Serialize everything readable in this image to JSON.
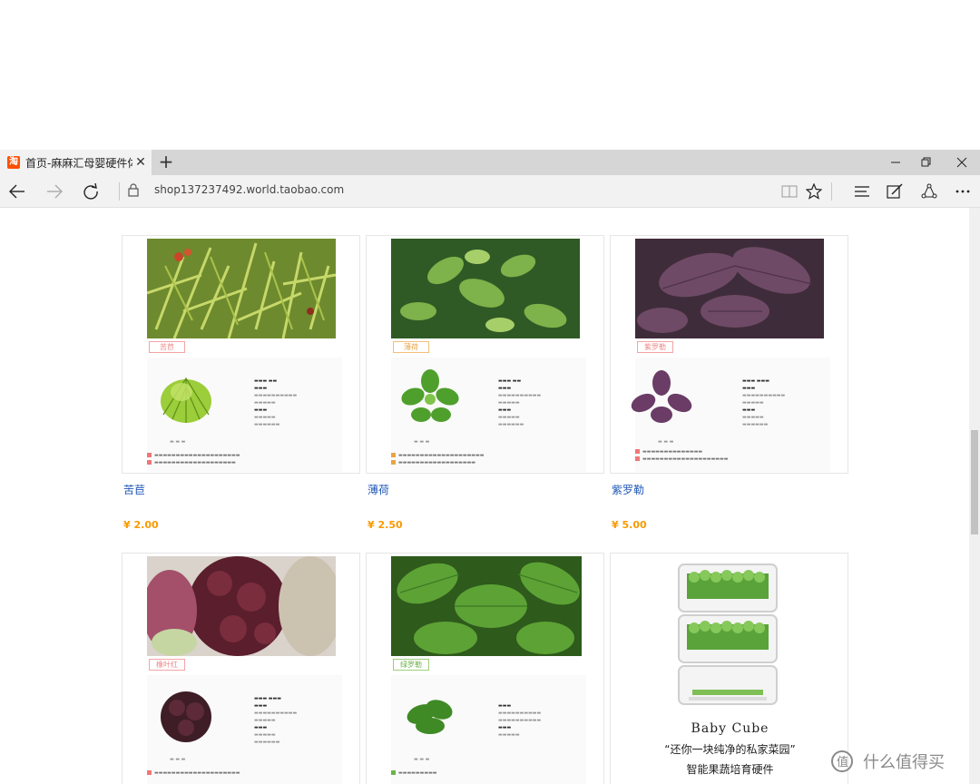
{
  "browser": {
    "tab_title": "首页-麻麻汇母婴硬件体",
    "tab_favicon": "淘",
    "url": "shop137237492.world.taobao.com"
  },
  "icons": [
    "back-icon",
    "forward-icon",
    "refresh-icon",
    "lock-icon",
    "reading-view-icon",
    "favorite-star-icon",
    "hub-icon",
    "web-note-icon",
    "share-icon",
    "more-icon",
    "minimize-icon",
    "restore-icon",
    "close-icon",
    "new-tab-icon"
  ],
  "products": [
    {
      "tag": "苦苣",
      "name": "苦苣",
      "price": "¥ 2.00"
    },
    {
      "tag": "薄荷",
      "name": "薄荷",
      "price": "¥ 2.50"
    },
    {
      "tag": "紫罗勒",
      "name": "紫罗勒",
      "price": "¥ 5.00"
    },
    {
      "tag": "橡叶红",
      "name": "",
      "price": ""
    },
    {
      "tag": "绿罗勒",
      "name": "",
      "price": ""
    }
  ],
  "promo": {
    "title": "Baby Cube",
    "line1": "“还你一块纯净的私家菜园”",
    "line2": "智能果蔬培育硬件"
  },
  "watermark": "什么值得买",
  "colors": {
    "accent_price": "#f99a00",
    "link": "#2259b8",
    "tag_border": "#f3a5a5"
  }
}
